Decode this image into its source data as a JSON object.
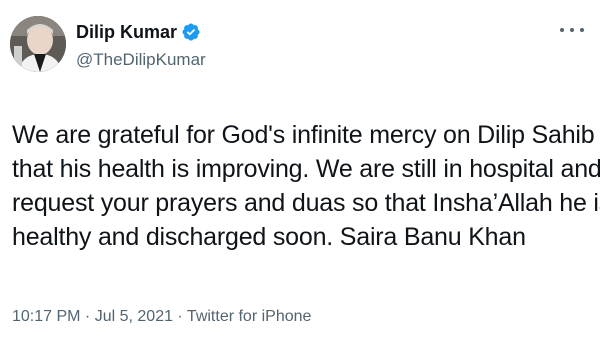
{
  "author": {
    "display_name": "Dilip Kumar",
    "handle": "@TheDilipKumar",
    "verified": true,
    "verified_badge_color": "#1d9bf0"
  },
  "more_menu_icon": "more-horizontal-icon",
  "tweet": {
    "text_lines": [
      "We are grateful for God's infinite mercy on Dilip Sahib",
      "that his health is improving. We are still in hospital and",
      "request your prayers and duas so that Insha’Allah he is",
      "healthy and discharged  soon. Saira Banu Khan"
    ]
  },
  "meta": {
    "time": "10:17 PM",
    "date": "Jul 5, 2021",
    "source": "Twitter for iPhone",
    "separator": " · "
  },
  "colors": {
    "text": "#0f1419",
    "secondary_text": "#536471",
    "background": "#ffffff"
  }
}
